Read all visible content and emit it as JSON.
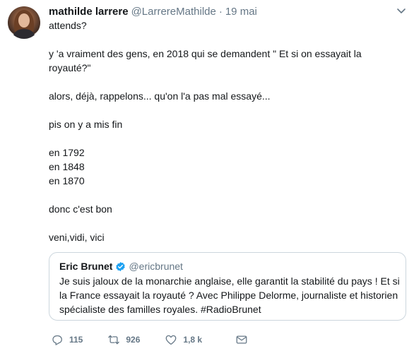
{
  "author": {
    "name": "mathilde larrere",
    "handle": "@LarrereMathilde",
    "separator": "·",
    "date": "19 mai"
  },
  "tweet": {
    "paragraphs": [
      "attends?",
      "y 'a vraiment des gens, en 2018 qui se demandent \" Et si on essayait la royauté?\"",
      "alors, déjà, rappelons... qu'on l'a pas mal essayé...",
      "pis on y a mis fin",
      "en 1792\nen 1848\nen 1870",
      "donc c'est bon",
      "veni,vidi, vici"
    ]
  },
  "quoted": {
    "name": "Eric Brunet",
    "handle": "@ericbrunet",
    "text": "Je suis jaloux de la monarchie anglaise, elle garantit la stabilité du pays ! Et si la France essayait la royauté ? Avec Philippe Delorme, journaliste et historien spécialiste des familles royales. #RadioBrunet"
  },
  "actions": {
    "reply_count": "115",
    "retweet_count": "926",
    "like_count": "1,8 k"
  },
  "icons": {
    "menu": "chevron-down-icon",
    "verified": "verified-badge-icon",
    "reply": "reply-icon",
    "retweet": "retweet-icon",
    "like": "heart-icon",
    "dm": "mail-icon"
  },
  "colors": {
    "text": "#14171a",
    "secondary": "#657786",
    "verified": "#1da1f2",
    "border": "#ccd6dd"
  }
}
